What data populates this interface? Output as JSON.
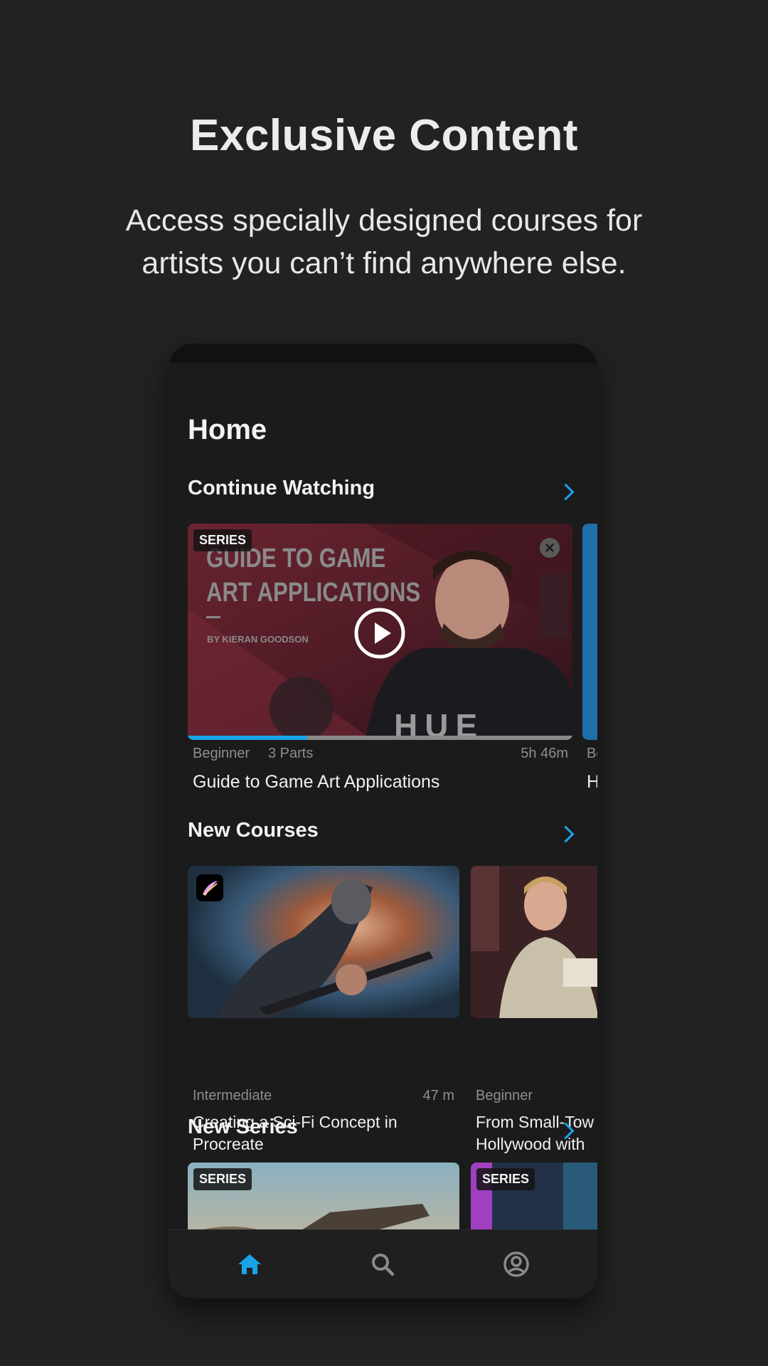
{
  "promo": {
    "title": "Exclusive Content",
    "subtitle": "Access specially designed courses for artists you can’t find anywhere else."
  },
  "app": {
    "page_title": "Home",
    "continue_watching": {
      "title": "Continue Watching",
      "card": {
        "badge": "SERIES",
        "thumb_heading_line1": "GUIDE TO GAME",
        "thumb_heading_line2": "ART APPLICATIONS",
        "thumb_byline": "BY KIERAN GOODSON",
        "shirt_text": "HUE",
        "level": "Beginner",
        "parts": "3 Parts",
        "duration": "5h 46m",
        "title": "Guide to Game Art Applications",
        "progress": 0.31
      },
      "next_card": {
        "level": "Be",
        "title": "H"
      }
    },
    "new_courses": {
      "title": "New Courses",
      "cards": [
        {
          "level": "Intermediate",
          "duration": "47 m",
          "title_line1": "Creating a Sci-Fi Concept in",
          "title_line2": "Procreate"
        },
        {
          "level": "Beginner",
          "duration": "",
          "title_line1": "From Small-Tow",
          "title_line2": "Hollywood with"
        }
      ]
    },
    "new_series": {
      "title": "New Series",
      "cards": [
        {
          "badge": "SERIES"
        },
        {
          "badge": "SERIES"
        }
      ]
    },
    "nav": [
      {
        "icon": "home-icon",
        "active": true
      },
      {
        "icon": "search-icon",
        "active": false
      },
      {
        "icon": "profile-icon",
        "active": false
      }
    ],
    "colors": {
      "accent": "#1aa3e8",
      "background": "#222222",
      "screen": "#1b1b1b"
    }
  }
}
